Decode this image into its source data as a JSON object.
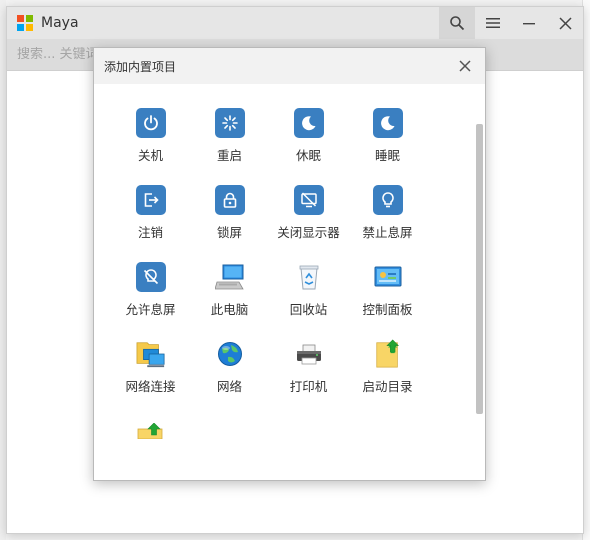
{
  "window": {
    "title": "Maya",
    "icons": {
      "search": "search-icon",
      "menu": "menu-icon",
      "minimize": "minimize-icon",
      "close": "close-icon"
    }
  },
  "search": {
    "value": "",
    "placeholder": "搜索... 关键词 / 正则表达式 / 终端命令"
  },
  "dialog": {
    "title": "添加内置项目",
    "items": [
      {
        "label": "关机",
        "icon": "power-icon"
      },
      {
        "label": "重启",
        "icon": "restart-icon"
      },
      {
        "label": "休眠",
        "icon": "moon-icon"
      },
      {
        "label": "睡眠",
        "icon": "moon-icon"
      },
      {
        "label": "注销",
        "icon": "logout-icon"
      },
      {
        "label": "锁屏",
        "icon": "lock-icon"
      },
      {
        "label": "关闭显示器",
        "icon": "monitor-off-icon"
      },
      {
        "label": "禁止息屏",
        "icon": "bulb-icon"
      },
      {
        "label": "允许息屏",
        "icon": "bulb-off-icon"
      },
      {
        "label": "此电脑",
        "icon": "computer-icon"
      },
      {
        "label": "回收站",
        "icon": "recycle-bin-icon"
      },
      {
        "label": "控制面板",
        "icon": "control-panel-icon"
      },
      {
        "label": "网络连接",
        "icon": "network-connections-icon"
      },
      {
        "label": "网络",
        "icon": "globe-icon"
      },
      {
        "label": "打印机",
        "icon": "printer-icon"
      },
      {
        "label": "启动目录",
        "icon": "startup-folder-icon"
      },
      {
        "label": "",
        "icon": "folder-up-icon"
      }
    ]
  },
  "colors": {
    "accent": "#3a7fc1",
    "titlebar": "#e6e6e6",
    "searchbar": "#dcdcdc"
  }
}
